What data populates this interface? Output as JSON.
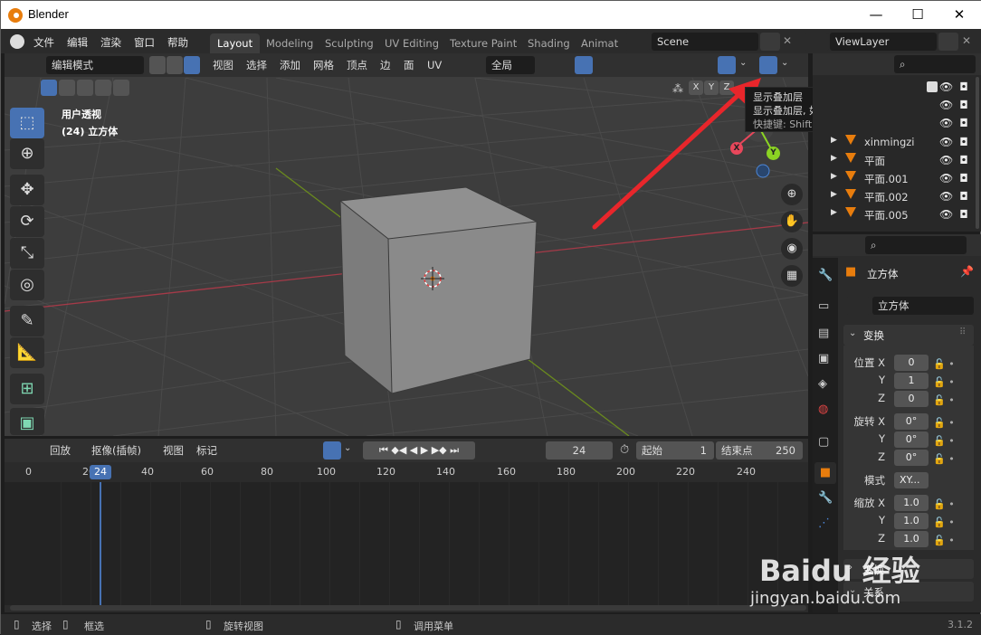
{
  "window": {
    "title": "Blender",
    "version": "3.1.2"
  },
  "menu": {
    "items": [
      "文件",
      "编辑",
      "渲染",
      "窗口",
      "帮助"
    ]
  },
  "workspace_tabs": [
    "Layout",
    "Modeling",
    "Sculpting",
    "UV Editing",
    "Texture Paint",
    "Shading",
    "Animat"
  ],
  "scene": {
    "name": "Scene"
  },
  "view_layer": {
    "name": "ViewLayer"
  },
  "viewport_header": {
    "mode": "编辑模式",
    "menus": [
      "视图",
      "选择",
      "添加",
      "网格",
      "顶点",
      "边",
      "面",
      "UV"
    ],
    "orientation": "全局",
    "axes": [
      "X",
      "Y",
      "Z"
    ]
  },
  "viewport": {
    "view_name": "用户透视",
    "object_label": "(24) 立方体"
  },
  "tooltip": {
    "title": "显示叠加层",
    "desc": "显示叠加层, 如 gizmos 和轮廓线.",
    "shortcut": "快捷键: Shift Alt Z"
  },
  "gizmo": {
    "x": "X",
    "y": "Y",
    "z": "Z"
  },
  "timeline": {
    "menus": [
      "回放",
      "抠像(插帧)",
      "视图",
      "标记"
    ],
    "current_frame": "24",
    "start_label": "起始",
    "start": "1",
    "end_label": "结束点",
    "end": "250",
    "ticks": [
      "0",
      "20",
      "40",
      "60",
      "80",
      "100",
      "120",
      "140",
      "160",
      "180",
      "200",
      "220",
      "240"
    ],
    "playhead": "24"
  },
  "outliner": {
    "rows": [
      {
        "name": "xinmingzi"
      },
      {
        "name": "平面"
      },
      {
        "name": "平面.001"
      },
      {
        "name": "平面.002"
      },
      {
        "name": "平面.005"
      }
    ]
  },
  "properties": {
    "object_name": "立方体",
    "data_name": "立方体",
    "panel_transform": "变换",
    "location_label": "位置 X",
    "rotation_label": "旋转 X",
    "scale_label": "缩放 X",
    "axis_y": "Y",
    "axis_z": "Z",
    "location": [
      "0",
      "1",
      "0"
    ],
    "rotation": [
      "0°",
      "0°",
      "0°"
    ],
    "mode_label": "模式",
    "mode_value": "XY...",
    "scale": [
      "1.0",
      "1.0",
      "1.0"
    ],
    "panel_delta": "变换",
    "panel_relations": "关系"
  },
  "status_bar": {
    "select": "选择",
    "box_select": "框选",
    "rotate": "旋转视图",
    "menu": "调用菜单"
  },
  "watermark": {
    "text1": "Baidu 经验",
    "text2": "jingyan.baidu.com"
  },
  "colors": {
    "accent": "#4772b3",
    "arrow": "#e8262b",
    "x_axis": "#e8475b",
    "y_axis": "#8bd323",
    "z_axis": "#4d87d8",
    "orange": "#e87d0d"
  }
}
